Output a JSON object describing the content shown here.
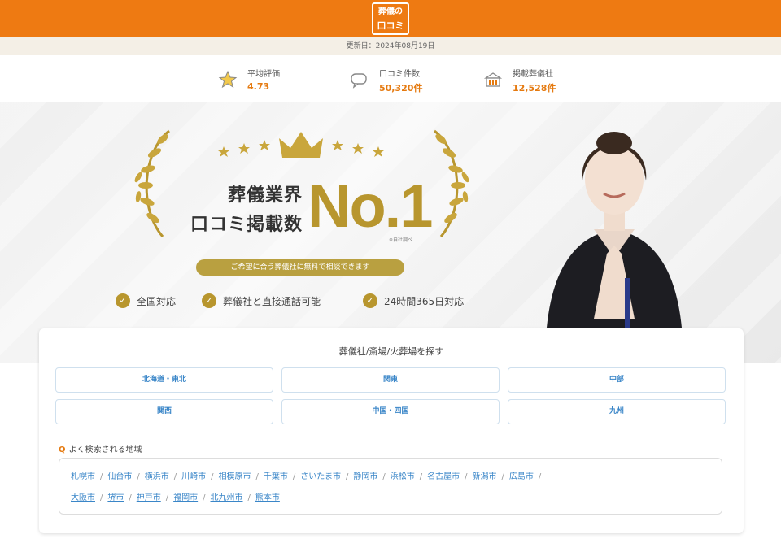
{
  "header": {
    "logo_line1": "葬儀の",
    "logo_line2": "口コミ"
  },
  "updated": "更新日：2024年08月19日",
  "stats": [
    {
      "icon": "star-icon",
      "label": "平均評価",
      "value": "4.73"
    },
    {
      "icon": "chat-icon",
      "label": "口コミ件数",
      "value": "50,320件"
    },
    {
      "icon": "building-icon",
      "label": "掲載葬儀社",
      "value": "12,528件"
    }
  ],
  "hero": {
    "line1": "葬儀業界",
    "line2": "口コミ掲載数",
    "no1": "No.1",
    "footnote": "※自社調べ",
    "pill": "ご希望に合う葬儀社に無料で相談できます",
    "features": [
      "全国対応",
      "葬儀社と直接通話可能",
      "24時間365日対応"
    ]
  },
  "search": {
    "title": "葬儀社/斎場/火葬場を探す",
    "regions": [
      "北海道・東北",
      "関東",
      "中部",
      "関西",
      "中国・四国",
      "九州"
    ],
    "popular_label": "よく検索される地域",
    "cities": [
      "札幌市",
      "仙台市",
      "横浜市",
      "川崎市",
      "相模原市",
      "千葉市",
      "さいたま市",
      "静岡市",
      "浜松市",
      "名古屋市",
      "新潟市",
      "広島市",
      "大阪市",
      "堺市",
      "神戸市",
      "福岡市",
      "北九州市",
      "熊本市"
    ]
  },
  "colors": {
    "brand": "#ee7a12",
    "gold": "#b8962e",
    "link": "#3a86c8"
  }
}
